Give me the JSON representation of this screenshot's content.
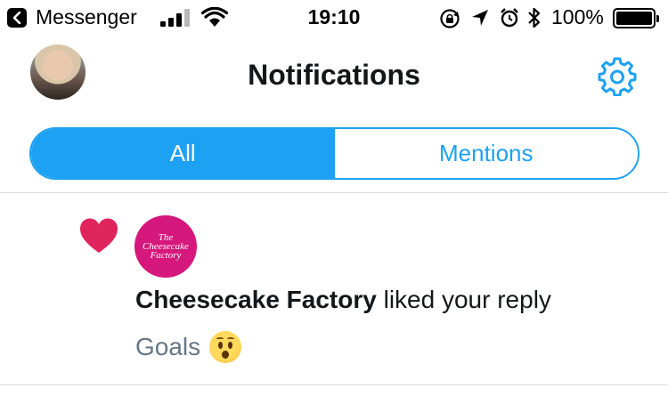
{
  "status_bar": {
    "back_app": "Messenger",
    "time": "19:10",
    "battery_percent": "100%",
    "battery_level": 1.0,
    "signal_bars": 3,
    "icons": [
      "back-icon",
      "signal-icon",
      "wifi-icon",
      "orientation-lock-icon",
      "location-icon",
      "alarm-icon",
      "bluetooth-icon",
      "battery-icon"
    ]
  },
  "header": {
    "title": "Notifications",
    "avatar_icon": "profile-avatar",
    "settings_icon": "gear-icon"
  },
  "tabs": [
    {
      "label": "All",
      "active": true
    },
    {
      "label": "Mentions",
      "active": false
    }
  ],
  "notification": {
    "type_icon": "heart-icon",
    "actor_logo_text": "The Cheesecake Factory",
    "actor": "Cheesecake Factory",
    "action": " liked your reply",
    "preview_text": "Goals",
    "preview_emoji": "hushed-face-icon"
  },
  "colors": {
    "accent": "#1da1f2",
    "heart": "#e0245e",
    "brand": "#d6177c",
    "secondary_text": "#657786"
  }
}
